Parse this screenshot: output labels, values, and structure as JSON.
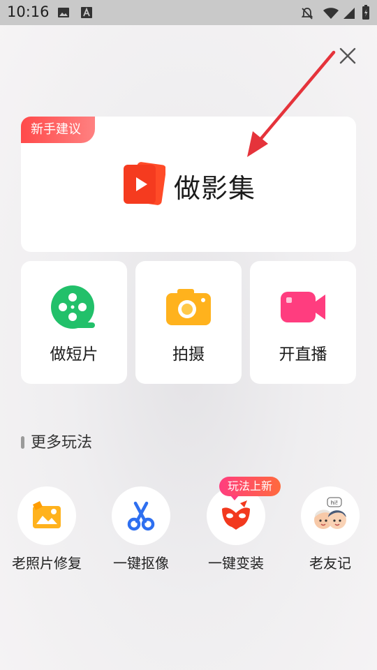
{
  "status_bar": {
    "time": "10:16",
    "icons": [
      "image-icon",
      "text-a-icon",
      "bell-off-icon",
      "wifi-icon",
      "signal-icon",
      "battery-icon"
    ]
  },
  "close_icon": "close-icon",
  "main_card": {
    "badge": "新手建议",
    "title": "做影集",
    "icon": "video-play-icon"
  },
  "actions": [
    {
      "label": "做短片",
      "icon": "film-reel-icon",
      "color": "#22c06a"
    },
    {
      "label": "拍摄",
      "icon": "camera-icon",
      "color": "#ffb21d"
    },
    {
      "label": "开直播",
      "icon": "video-camera-icon",
      "color": "#ff3d7f"
    }
  ],
  "section": {
    "title": "更多玩法"
  },
  "tools": [
    {
      "label": "老照片修复",
      "icon": "photo-repair-icon"
    },
    {
      "label": "一键抠像",
      "icon": "scissors-icon"
    },
    {
      "label": "一键变装",
      "icon": "mask-icon",
      "tag": "玩法上新"
    },
    {
      "label": "老友记",
      "icon": "friends-faces-icon",
      "bubble": "hi!"
    }
  ],
  "colors": {
    "accent_red": "#ff4a4a",
    "arrow_red": "#e5333b"
  }
}
